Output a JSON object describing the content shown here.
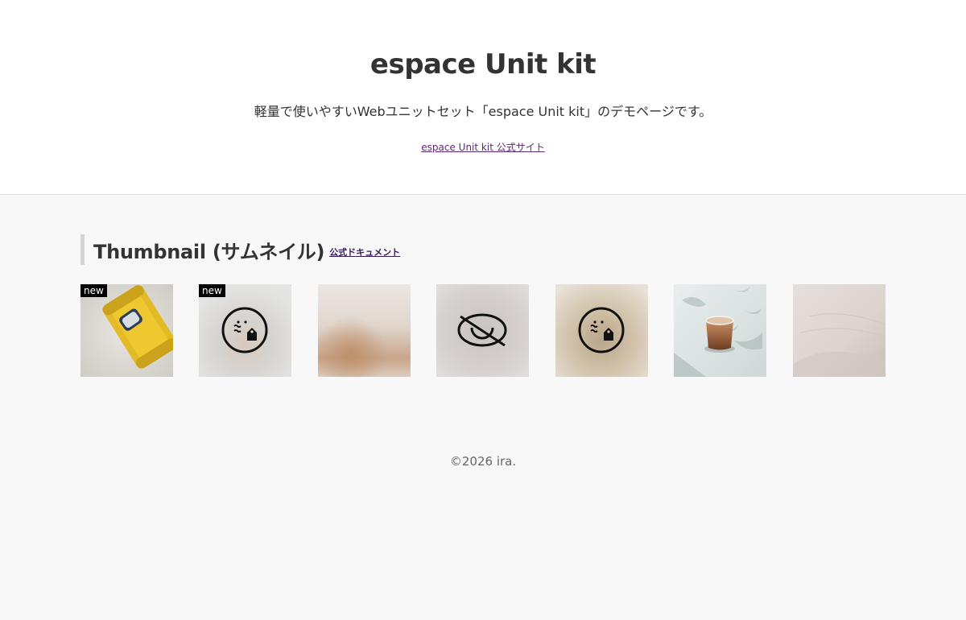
{
  "header": {
    "title": "espace Unit kit",
    "description": "軽量で使いやすいWebユニットセット「espace Unit kit」のデモページです。",
    "official_link": "espace Unit kit 公式サイト"
  },
  "section": {
    "title": "Thumbnail (サムネイル)",
    "doc_link": "公式ドキュメント"
  },
  "thumbnails": [
    {
      "badge": "new",
      "content": "yellow-sofa-photo"
    },
    {
      "badge": "new",
      "content": "image-error-icon"
    },
    {
      "badge": "",
      "content": "blurred-photo"
    },
    {
      "badge": "",
      "content": "hidden-eye-icon"
    },
    {
      "badge": "",
      "content": "image-error-icon"
    },
    {
      "badge": "",
      "content": "coffee-glass-photo"
    },
    {
      "badge": "",
      "content": "sand-dune-photo"
    }
  ],
  "footer": {
    "copyright": "©2026 ira."
  }
}
